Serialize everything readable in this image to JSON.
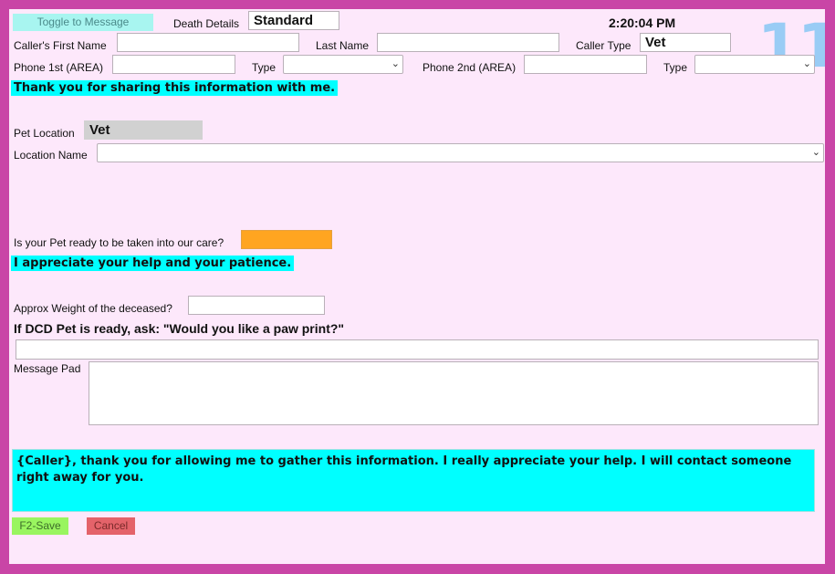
{
  "header": {
    "toggle_label": "Toggle to Message",
    "death_details_label": "Death Details",
    "death_details_value": "Standard",
    "clock": "2:20:04 PM",
    "counter": "11"
  },
  "caller": {
    "first_name_label": "Caller's First Name",
    "first_name_value": "",
    "last_name_label": "Last Name",
    "last_name_value": "",
    "caller_type_label": "Caller Type",
    "caller_type_value": "Vet",
    "phone1_label": "Phone 1st (AREA)",
    "phone1_value": "",
    "type1_label": "Type",
    "type1_value": "",
    "phone2_label": "Phone 2nd (AREA)",
    "phone2_value": "",
    "type2_label": "Type",
    "type2_value": ""
  },
  "script_line_1": "Thank you for sharing this information with me.",
  "pet": {
    "location_label": "Pet Location",
    "location_value": "Vet",
    "location_name_label": "Location Name",
    "location_name_value": "",
    "ready_label": "Is your Pet ready to be taken into our care?"
  },
  "script_line_2": "I appreciate your help and your patience.",
  "weight": {
    "label": "Approx Weight of the deceased?",
    "value": ""
  },
  "paw_print": {
    "question": "If DCD Pet is ready, ask: \"Would you like a paw print?\"",
    "value": ""
  },
  "message_pad": {
    "label": "Message Pad",
    "value": ""
  },
  "closing_script": "{Caller}, thank you for allowing me to gather this information.  I really appreciate your help.  I will contact someone right away for you.",
  "buttons": {
    "save": "F2-Save",
    "cancel": "Cancel"
  },
  "colors": {
    "frame": "#c945a6",
    "panel": "#fde8fb",
    "highlight": "#00ffff",
    "toggle_bg": "#a8f5f0",
    "ready_indicator": "#ffa520",
    "save_bg": "#99f55f",
    "cancel_bg": "#e4636a",
    "counter": "#99ccf5",
    "readonly_field": "#d1d1d1"
  }
}
